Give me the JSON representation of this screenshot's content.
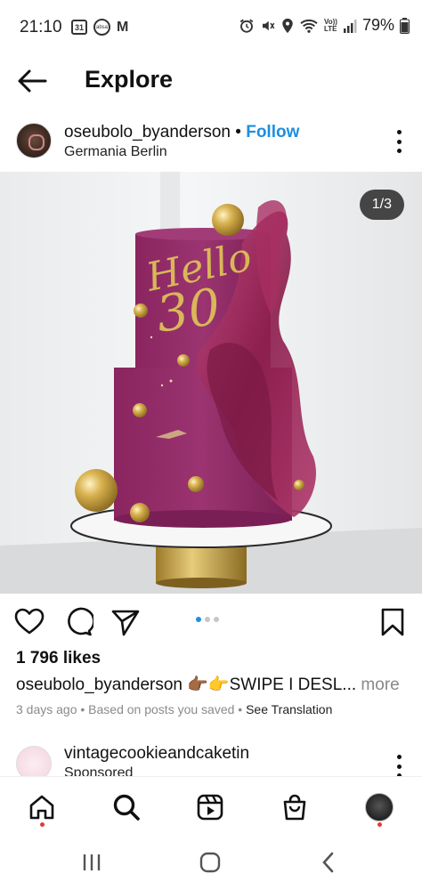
{
  "status_bar": {
    "time": "21:10",
    "calendar_day": "31",
    "small_icon_text": "absa",
    "mail_letter": "M",
    "network": "LTE",
    "network_top": "Vo))",
    "battery": "79%"
  },
  "header": {
    "title": "Explore"
  },
  "post": {
    "username": "oseubolo_byanderson",
    "separator": "•",
    "follow_label": "Follow",
    "location": "Germania Berlin",
    "image_counter": "1/3",
    "carousel_index": 1,
    "carousel_total": 3,
    "likes": "1 796 likes",
    "caption_user": "oseubolo_byanderson",
    "caption_text": " 👉🏾👉SWIPE I DESL...",
    "caption_more": " more",
    "time_ago": "3 days ago",
    "based_on": " • Based on posts you saved • ",
    "see_translation": "See Translation",
    "cake_topper_line1": "Hello",
    "cake_topper_line2": "30"
  },
  "next_post": {
    "username": "vintagecookieandcaketin",
    "subtitle": "Sponsored"
  },
  "colors": {
    "accent": "#1d8fe0",
    "cake": "#8e2a63",
    "gold": "#c9a13a",
    "notification_dot": "#e53935"
  },
  "icons": {
    "back": "arrow-left-icon",
    "like": "heart-icon",
    "comment": "comment-icon",
    "share": "send-icon",
    "save": "bookmark-icon",
    "nav_home": "home-icon",
    "nav_search": "search-icon",
    "nav_reels": "reels-icon",
    "nav_shop": "shop-bag-icon"
  }
}
